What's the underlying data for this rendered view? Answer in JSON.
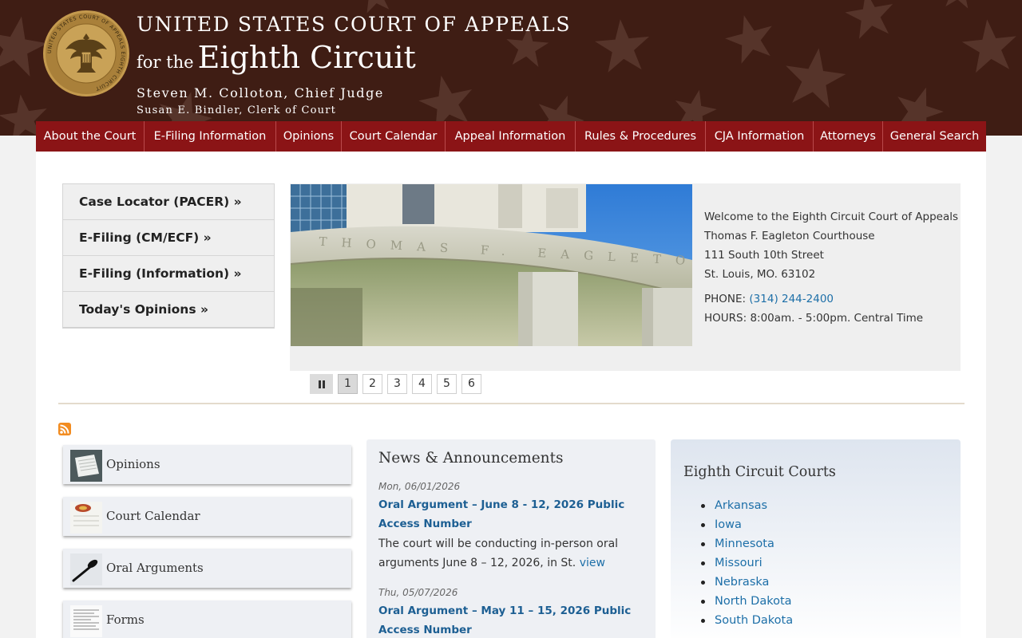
{
  "header": {
    "title_line1": "UNITED STATES COURT OF APPEALS",
    "title_for_the": "for the",
    "title_circuit": "Eighth Circuit",
    "chief_judge": "Steven M. Colloton, Chief Judge",
    "clerk": "Susan E. Bindler, Clerk of Court",
    "seal_text": "UNITED STATES COURT OF APPEALS EIGHTH CIRCUIT",
    "colors": {
      "background": "#3f1d14",
      "nav": "#8b1416"
    }
  },
  "nav": {
    "items": [
      {
        "label": "About the Court"
      },
      {
        "label": "E-Filing Information"
      },
      {
        "label": "Opinions"
      },
      {
        "label": "Court Calendar"
      },
      {
        "label": "Appeal Information"
      },
      {
        "label": "Rules & Procedures"
      },
      {
        "label": "CJA Information"
      },
      {
        "label": "Attorneys"
      },
      {
        "label": "General Search"
      }
    ]
  },
  "quick_links": [
    {
      "label": "Case Locator (PACER) »"
    },
    {
      "label": "E-Filing (CM/ECF) »"
    },
    {
      "label": "E-Filing (Information) »"
    },
    {
      "label": "Today's Opinions »"
    }
  ],
  "slider": {
    "photo_caption_text": "THOMAS F. EAGLETON",
    "welcome": "Welcome to the Eighth Circuit Court of Appeals",
    "building": "Thomas F. Eagleton Courthouse",
    "street": "111 South 10th Street",
    "city": "St. Louis, MO. 63102",
    "phone_label": "PHONE:",
    "phone": "(314) 244-2400",
    "hours": "HOURS: 8:00am. - 5:00pm. Central Time",
    "pages": [
      "1",
      "2",
      "3",
      "4",
      "5",
      "6"
    ],
    "active_page": "1",
    "pause_icon": "pause-icon"
  },
  "resources": [
    {
      "label": "Opinions",
      "icon": "opinions-thumbnail"
    },
    {
      "label": "Court Calendar",
      "icon": "calendar-thumbnail"
    },
    {
      "label": "Oral Arguments",
      "icon": "microphone-thumbnail"
    },
    {
      "label": "Forms",
      "icon": "forms-thumbnail"
    }
  ],
  "news": {
    "title": "News & Announcements",
    "items": [
      {
        "date": "Mon, 06/01/2026",
        "link": "Oral Argument – June 8 - 12, 2026 Public Access Number",
        "body": "The court will be conducting in-person oral arguments June 8 – 12, 2026, in St.",
        "more": "view"
      },
      {
        "date": "Thu, 05/07/2026",
        "link": "Oral Argument – May 11 – 15, 2026 Public Access Number"
      }
    ]
  },
  "courts": {
    "title": "Eighth Circuit Courts",
    "items": [
      "Arkansas",
      "Iowa",
      "Minnesota",
      "Missouri",
      "Nebraska",
      "North Dakota",
      "South Dakota"
    ]
  }
}
